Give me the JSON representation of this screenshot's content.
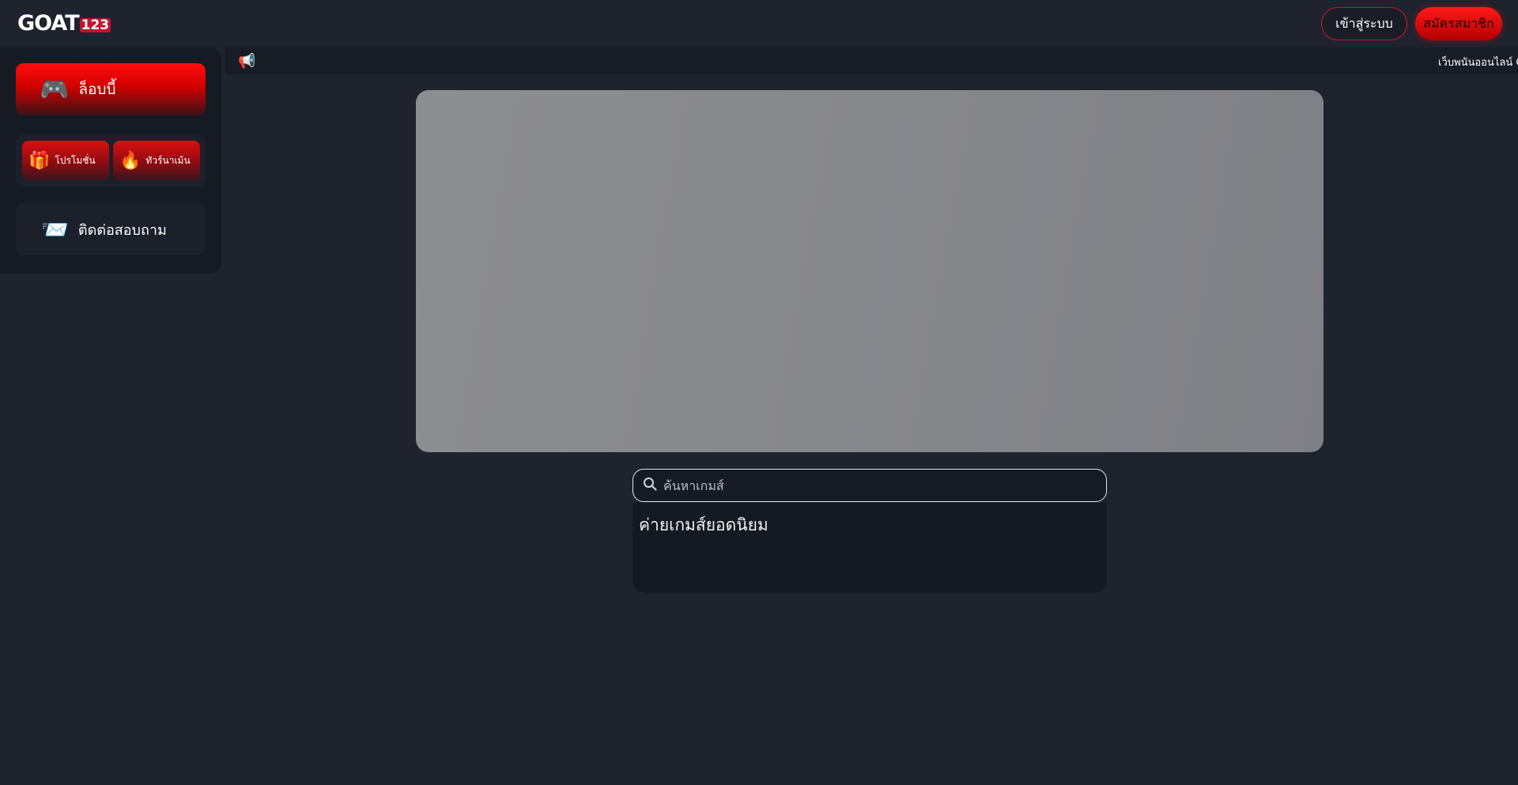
{
  "header": {
    "logo_main": "GOAT",
    "logo_num": "123",
    "login_label": "เข้าสู่ระบบ",
    "register_label": "สมัครสมาชิก"
  },
  "sidebar": {
    "lobby": {
      "icon": "gamepad-icon",
      "label": "ล็อบบี้"
    },
    "promotion": {
      "icon": "gift-icon",
      "label": "โปรโมชั่น"
    },
    "recommended": {
      "icon": "fire-icon",
      "label": "ทัวร์นาเม้น"
    },
    "contact": {
      "icon": "paper-plane-icon",
      "label": "ติดต่อสอบถาม"
    }
  },
  "announcement": {
    "icon": "megaphone-icon",
    "text": "เว็บพนันออนไลน์ G"
  },
  "search": {
    "placeholder": "ค้นหาเกมส์",
    "value": ""
  },
  "providers": {
    "title": "ค่ายเกมส์ยอดนิยม"
  },
  "colors": {
    "background": "#1f232d",
    "accent_red": "#e10000",
    "panel": "#161a23"
  }
}
